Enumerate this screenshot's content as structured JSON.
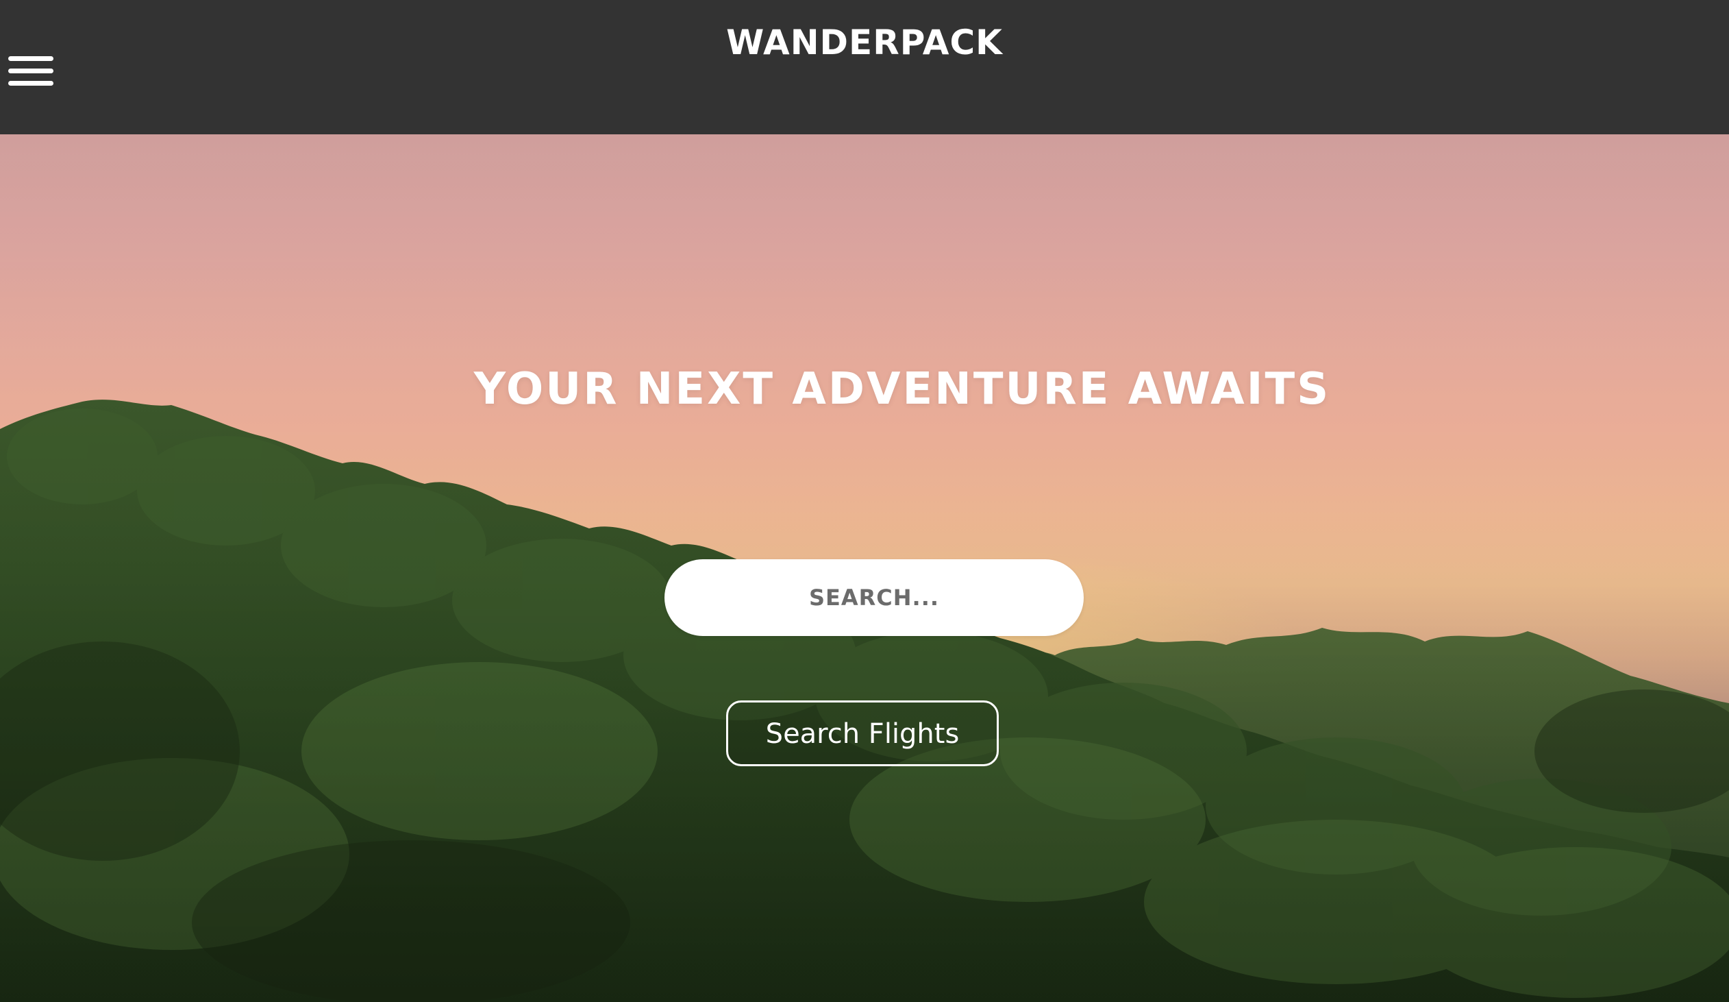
{
  "header": {
    "brand": "WANDERPACK",
    "menu_icon": "hamburger-menu-icon",
    "background_color": "#333333"
  },
  "hero": {
    "headline": "YOUR NEXT ADVENTURE AWAITS",
    "background_image": "sunset-over-forest"
  },
  "search": {
    "placeholder": "SEARCH...",
    "value": ""
  },
  "actions": {
    "search_flights_label": "Search Flights"
  }
}
